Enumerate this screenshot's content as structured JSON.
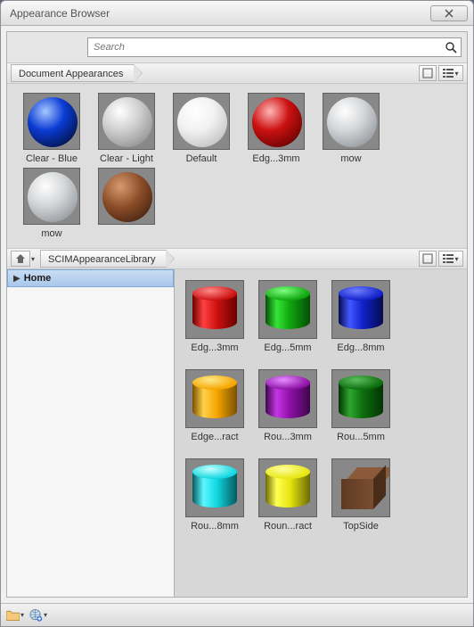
{
  "window": {
    "title": "Appearance Browser"
  },
  "search": {
    "placeholder": "Search"
  },
  "sections": {
    "doc_label": "Document Appearances",
    "lib_crumb": "SCIMAppearanceLibrary"
  },
  "doc_items": [
    {
      "label": "Clear - Blue",
      "kind": "ball-blue"
    },
    {
      "label": "Clear - Light",
      "kind": "ball-clear"
    },
    {
      "label": "Default",
      "kind": "ball-white"
    },
    {
      "label": "Edg...3mm",
      "kind": "ball-red"
    },
    {
      "label": "mow",
      "kind": "ball-grey"
    },
    {
      "label": "mow",
      "kind": "ball-grey"
    },
    {
      "label": "",
      "kind": "ball-leather"
    }
  ],
  "tree": {
    "root": "Home"
  },
  "lib_items": [
    {
      "label": "Edg...3mm",
      "kind": "cyl-red"
    },
    {
      "label": "Edg...5mm",
      "kind": "cyl-green"
    },
    {
      "label": "Edg...8mm",
      "kind": "cyl-blue"
    },
    {
      "label": "Edge...ract",
      "kind": "cyl-orange"
    },
    {
      "label": "Rou...3mm",
      "kind": "cyl-purple"
    },
    {
      "label": "Rou...5mm",
      "kind": "cyl-dgreen"
    },
    {
      "label": "Rou...8mm",
      "kind": "cyl-cyan"
    },
    {
      "label": "Roun...ract",
      "kind": "cyl-yellow"
    },
    {
      "label": "TopSide",
      "kind": "cube-wood"
    }
  ]
}
